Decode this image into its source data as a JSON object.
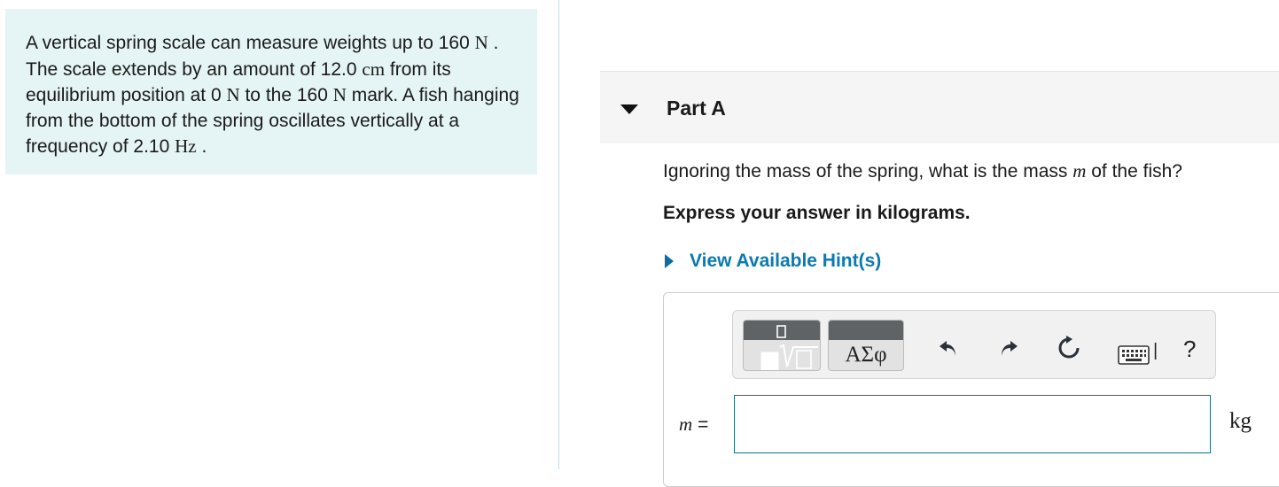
{
  "problem": {
    "segments": [
      {
        "text": "A vertical spring scale can measure weights up to 160 ",
        "style": "text"
      },
      {
        "text": "N",
        "style": "serif"
      },
      {
        "text": " . The scale extends by an amount of 12.0 ",
        "style": "text"
      },
      {
        "text": "cm",
        "style": "serif"
      },
      {
        "text": " from its equilibrium position at 0 ",
        "style": "text"
      },
      {
        "text": "N",
        "style": "serif"
      },
      {
        "text": " to the 160 ",
        "style": "text"
      },
      {
        "text": "N",
        "style": "serif"
      },
      {
        "text": " mark. A fish hanging from the bottom of the spring oscillates vertically at a frequency of 2.10 ",
        "style": "text"
      },
      {
        "text": "Hz",
        "style": "serif"
      },
      {
        "text": " .",
        "style": "text"
      }
    ]
  },
  "part": {
    "title": "Part A"
  },
  "question": {
    "before": "Ignoring the mass of the spring, what is the mass ",
    "variable": "m",
    "after": " of the fish?"
  },
  "instruction": "Express your answer in kilograms.",
  "hint_link": "View Available Hint(s)",
  "toolbar": {
    "greek_label": "ΑΣφ",
    "help_label": "?",
    "keyboard_separator": "|",
    "icons": [
      "templates-icon",
      "greek-letters-icon",
      "undo-icon",
      "redo-icon",
      "reset-icon",
      "keyboard-icon",
      "help-icon"
    ]
  },
  "answer": {
    "variable": "m",
    "equals": "=",
    "value": "",
    "unit": "kg"
  },
  "colors": {
    "problem_bg": "#e5f4f4",
    "link": "#0a7ab0",
    "input_border": "#1c6f87",
    "toolbar_band": "#5f6366"
  }
}
